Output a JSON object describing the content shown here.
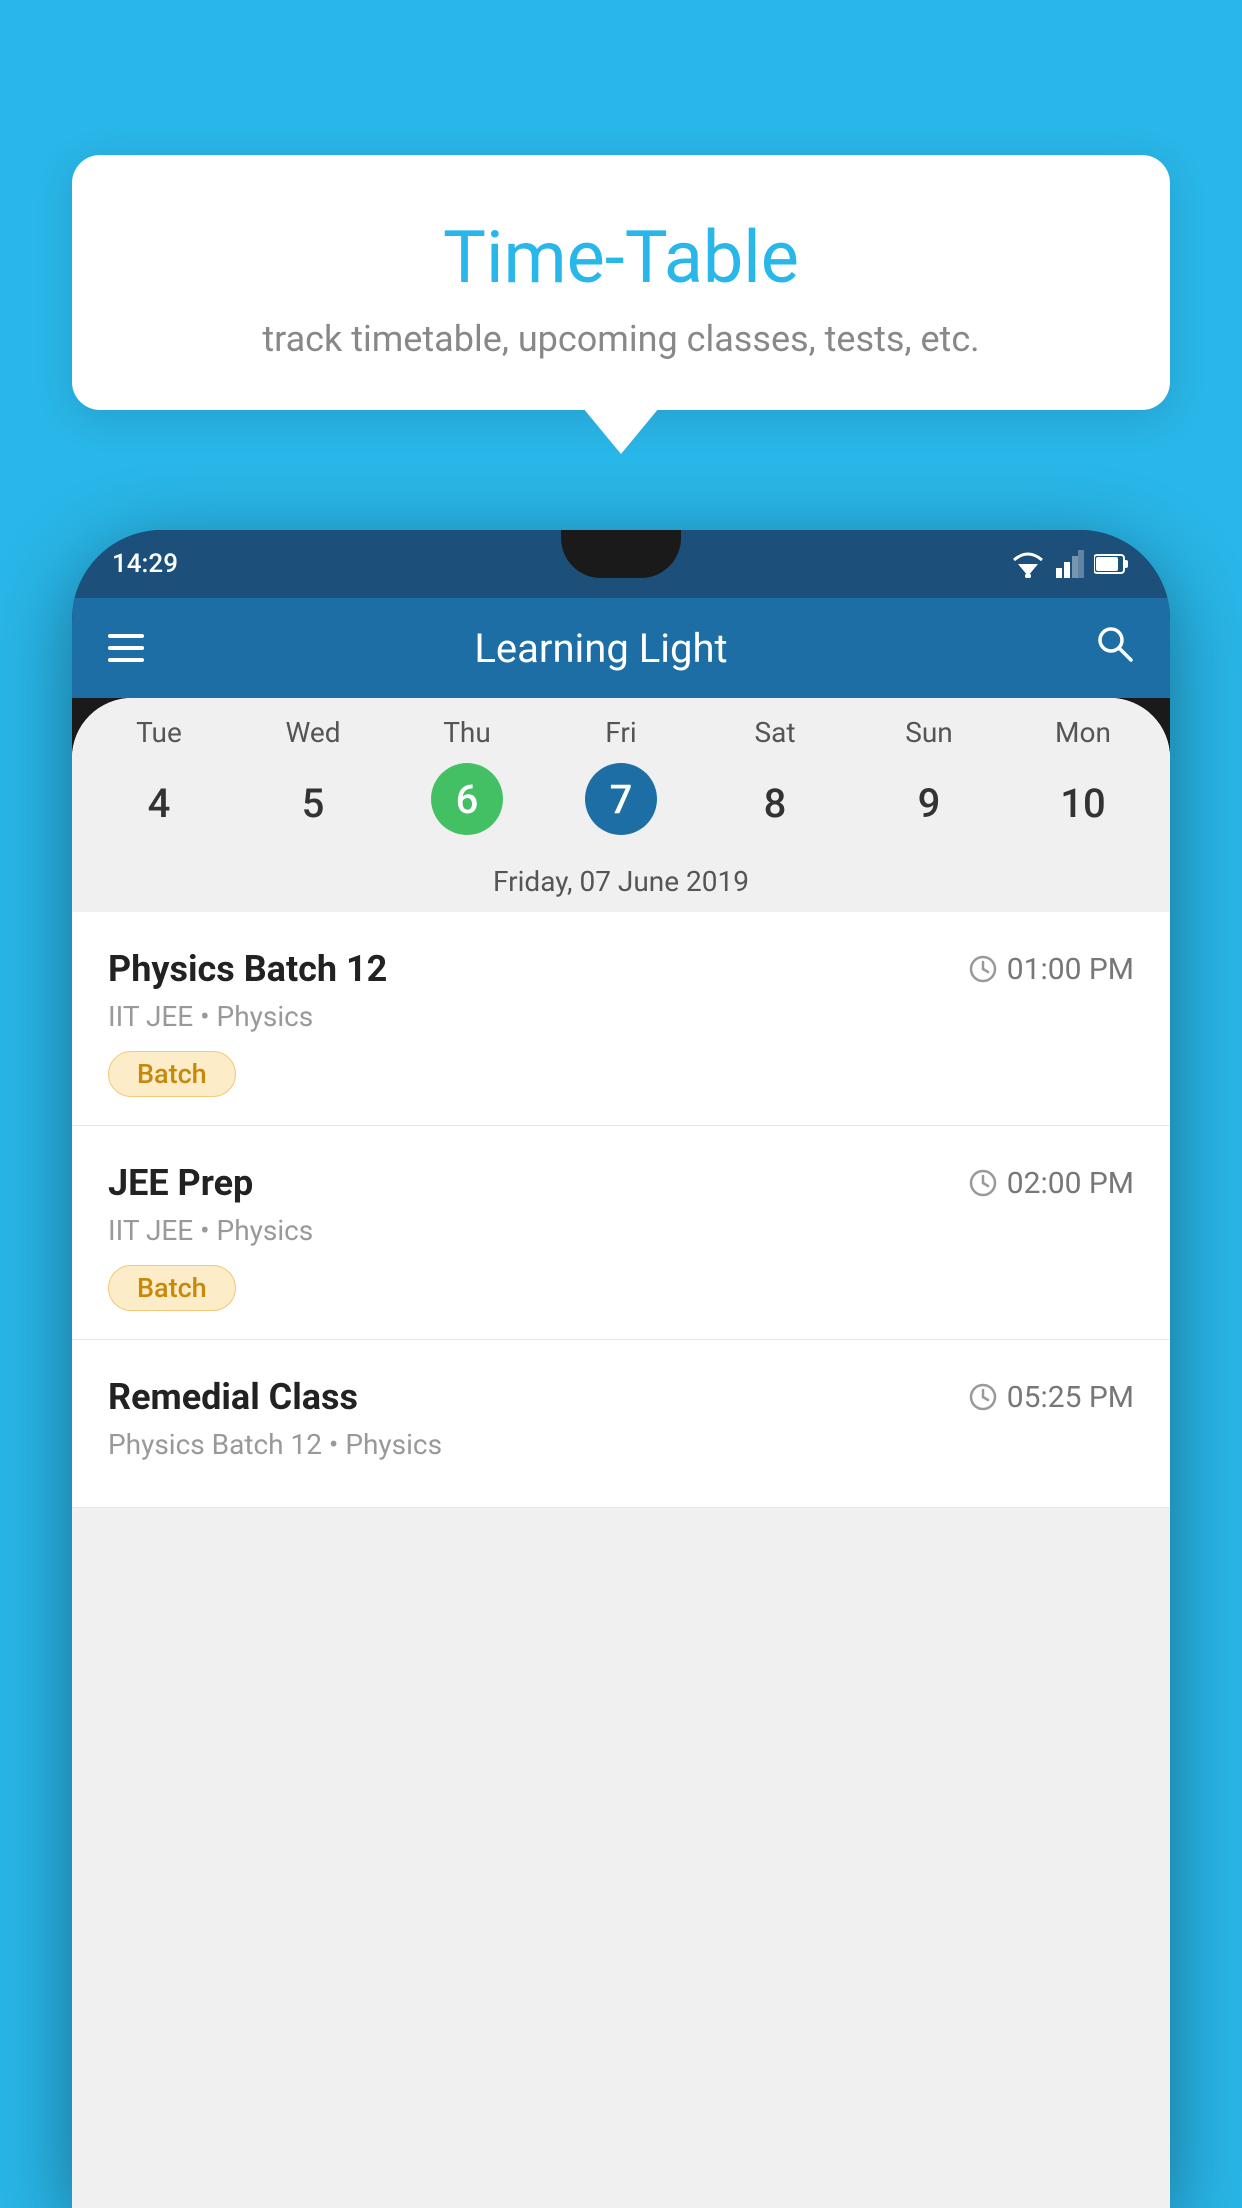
{
  "background_color": "#29B6E8",
  "tooltip": {
    "title": "Time-Table",
    "subtitle": "track timetable, upcoming classes, tests, etc."
  },
  "phone": {
    "status_bar": {
      "time": "14:29"
    },
    "app_bar": {
      "title": "Learning Light",
      "hamburger_label": "menu",
      "search_label": "search"
    },
    "calendar": {
      "day_headers": [
        "Tue",
        "Wed",
        "Thu",
        "Fri",
        "Sat",
        "Sun",
        "Mon"
      ],
      "day_numbers": [
        "4",
        "5",
        "6",
        "7",
        "8",
        "9",
        "10"
      ],
      "today_index": 2,
      "selected_index": 3,
      "date_label": "Friday, 07 June 2019"
    },
    "schedule": [
      {
        "title": "Physics Batch 12",
        "time": "01:00 PM",
        "subtitle": "IIT JEE • Physics",
        "badge": "Batch"
      },
      {
        "title": "JEE Prep",
        "time": "02:00 PM",
        "subtitle": "IIT JEE • Physics",
        "badge": "Batch"
      },
      {
        "title": "Remedial Class",
        "time": "05:25 PM",
        "subtitle": "Physics Batch 12 • Physics",
        "badge": null
      }
    ]
  }
}
